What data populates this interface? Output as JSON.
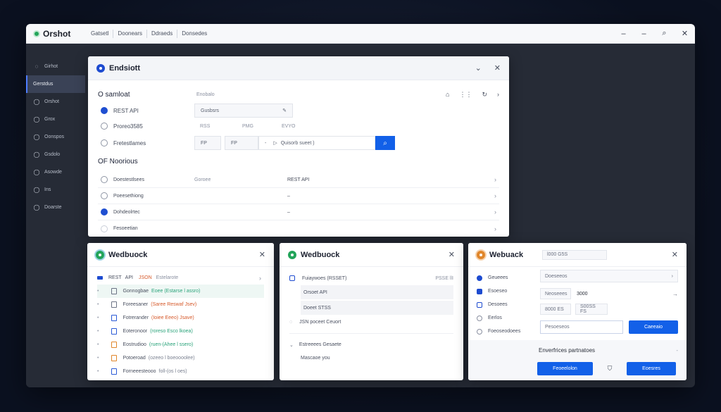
{
  "app": {
    "name": "Orshot",
    "menu": [
      "Gatsetl",
      "Doonears",
      "Ddraeds",
      "Donsedes"
    ],
    "controls": {
      "minimize": "–",
      "maximize": "–",
      "search": "⌕",
      "close": "✕"
    }
  },
  "sidebar": {
    "items": [
      {
        "label": "Girhot",
        "icon": "◌"
      },
      {
        "label": "Gerstdus",
        "icon": ""
      },
      {
        "label": "Orshot",
        "icon": "◯"
      },
      {
        "label": "Grox",
        "icon": "◯"
      },
      {
        "label": "Oonspos",
        "icon": "◯"
      },
      {
        "label": "Gsdolo",
        "icon": "◯"
      },
      {
        "label": "Asowde",
        "icon": "◯"
      },
      {
        "label": "Ins",
        "icon": "◯"
      },
      {
        "label": "Doarste",
        "icon": "◯"
      }
    ]
  },
  "main_panel": {
    "title": "Endsiott",
    "section1": "O samloat",
    "col_header": "Enobalo",
    "rows": [
      {
        "label": "REST API",
        "field": "Gusbsrs"
      },
      {
        "label": "Proreo3585",
        "a": "RSS",
        "b": "PMG",
        "c": "EVYO"
      },
      {
        "label": "Fretestlames",
        "fp1": "FP",
        "fp2": "FP",
        "search": "Quisorb sueet )"
      }
    ],
    "section2": "OF Noorious",
    "list": [
      {
        "label": "Doestestlsees",
        "mid": "Goroee",
        "right": "REST API"
      },
      {
        "label": "Poeesethiong",
        "mid": "",
        "right": "–"
      },
      {
        "label": "Dohdeolrtec",
        "mid": "",
        "right": "–"
      },
      {
        "label": "Fesoeetian",
        "mid": "",
        "right": ""
      }
    ]
  },
  "panel_a": {
    "title": "Wedbuock",
    "header_row": {
      "a": "REST",
      "b": "API",
      "c": "JSON",
      "d": "Estelarote"
    },
    "rows": [
      {
        "name": "Gonnogbae",
        "tail": "Eoee (Estarse l assro)",
        "color": "#2aa37a"
      },
      {
        "name": "Foreesaner",
        "tail": "(Saree Reswaf Jsev)",
        "color": "#d65a2b"
      },
      {
        "name": "Fotrerander",
        "tail": "(Ioiee Eeeo) Jsave)",
        "color": "#d65a2b"
      },
      {
        "name": "Eoteronoor",
        "tail": "(roreso Esco lkoea)",
        "color": "#2aa37a"
      },
      {
        "name": "Eostrudioo",
        "tail": "(ruen-(Ahee l ssero)",
        "color": "#2aa37a"
      },
      {
        "name": "Potoeroad",
        "tail": "(ozeeo l boeoooolee)",
        "color": "#7a8090"
      },
      {
        "name": "Forneeesteooo",
        "tail": "foll-(os l oes)",
        "color": "#7a8090"
      }
    ]
  },
  "panel_b": {
    "title": "Wedbuock",
    "rows": [
      {
        "label": "Fuiaywoes (RSSET)",
        "tag": "PSSE llI"
      },
      {
        "label": "Orsoet API",
        "tag": ""
      },
      {
        "label": "Doeet STSS",
        "tag": ""
      },
      {
        "label": "JSN poceet Ceuort",
        "tag": ""
      }
    ],
    "footer": [
      "Estreeees Gesaete",
      "Mascaoe you"
    ]
  },
  "panel_c": {
    "title": "Webuack",
    "side_items": [
      "Geueees",
      "Esoeseo",
      "Desoees",
      "Eerlos",
      "Foeoseodoees"
    ],
    "fields": {
      "top": "l000 G5S",
      "r1": "Doeseeos",
      "r2a": "Neoseees",
      "r2b": "3000",
      "r3a": "8000 ES",
      "r3b": "S00SS FS",
      "input": "Pesoeseos",
      "btn": "Caeeaio"
    },
    "footer_title": "Enverfrices  partnatoes",
    "footer_btn1": "Feoeelolon",
    "footer_btn2": "Eoesres"
  }
}
